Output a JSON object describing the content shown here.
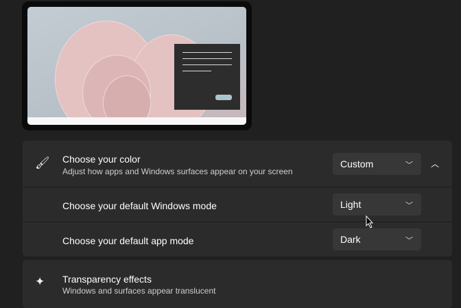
{
  "color_section": {
    "title": "Choose your color",
    "subtitle": "Adjust how apps and Windows surfaces appear on your screen",
    "value": "Custom"
  },
  "windows_mode": {
    "title": "Choose your default Windows mode",
    "value": "Light"
  },
  "app_mode": {
    "title": "Choose your default app mode",
    "value": "Dark"
  },
  "transparency": {
    "title": "Transparency effects",
    "subtitle": "Windows and surfaces appear translucent"
  },
  "icons": {
    "color": "paintbrush-icon",
    "transparency": "transparency-icon",
    "chevron": "chevron-down-icon",
    "collapse": "chevron-up-icon"
  }
}
